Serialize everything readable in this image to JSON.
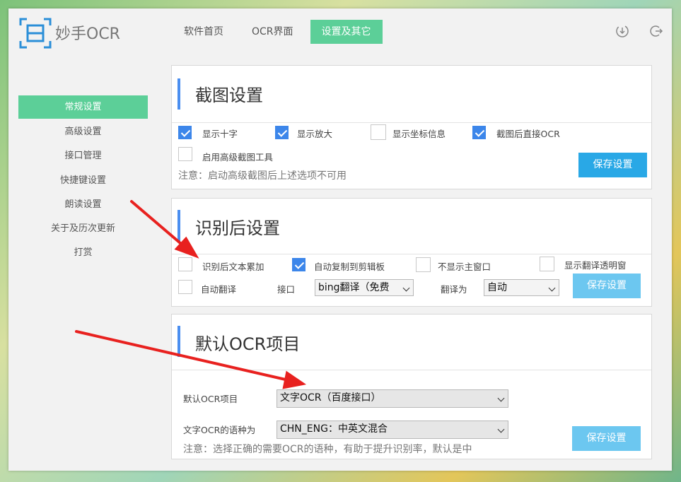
{
  "app": {
    "name": "妙手OCR"
  },
  "topnav": [
    "软件首页",
    "OCR界面",
    "设置及其它"
  ],
  "titlebar_icons": [
    "download-icon",
    "logout-icon"
  ],
  "sidebar": {
    "items": [
      "常规设置",
      "高级设置",
      "接口管理",
      "快捷键设置",
      "朗读设置",
      "关于及历次更新",
      "打赏"
    ]
  },
  "screenshot_settings": {
    "title": "截图设置",
    "options": [
      {
        "label": "显示十字",
        "checked": true
      },
      {
        "label": "显示放大",
        "checked": true
      },
      {
        "label": "显示坐标信息",
        "checked": false
      },
      {
        "label": "截图后直接OCR",
        "checked": true
      },
      {
        "label": "启用高级截图工具",
        "checked": false
      }
    ],
    "note": "注意：启动高级截图后上述选项不可用",
    "save_label": "保存设置"
  },
  "post_recognition": {
    "title": "识别后设置",
    "options": [
      {
        "label": "识别后文本累加",
        "checked": false
      },
      {
        "label": "自动复制到剪辑板",
        "checked": true
      },
      {
        "label": "不显示主窗口",
        "checked": false
      },
      {
        "label": "显示翻译透明窗",
        "checked": false
      },
      {
        "label": "自动翻译",
        "checked": false
      }
    ],
    "api_label": "接口",
    "api_value": "bing翻译（免费",
    "translate_to_label": "翻译为",
    "translate_to_value": "自动",
    "save_label": "保存设置"
  },
  "default_ocr": {
    "title": "默认OCR项目",
    "item_label": "默认OCR项目",
    "item_value": "文字OCR（百度接口）",
    "lang_label": "文字OCR的语种为",
    "lang_value": "CHN_ENG：中英文混合",
    "note": "注意：选择正确的需要OCR的语种，有助于提升识别率，默认是中",
    "save_label": "保存设置"
  },
  "colors": {
    "accent_green": "#5ccf98",
    "accent_blue": "#4a8ef0",
    "button_blue": "#29a8e6",
    "annotation_red": "#e8211f"
  }
}
